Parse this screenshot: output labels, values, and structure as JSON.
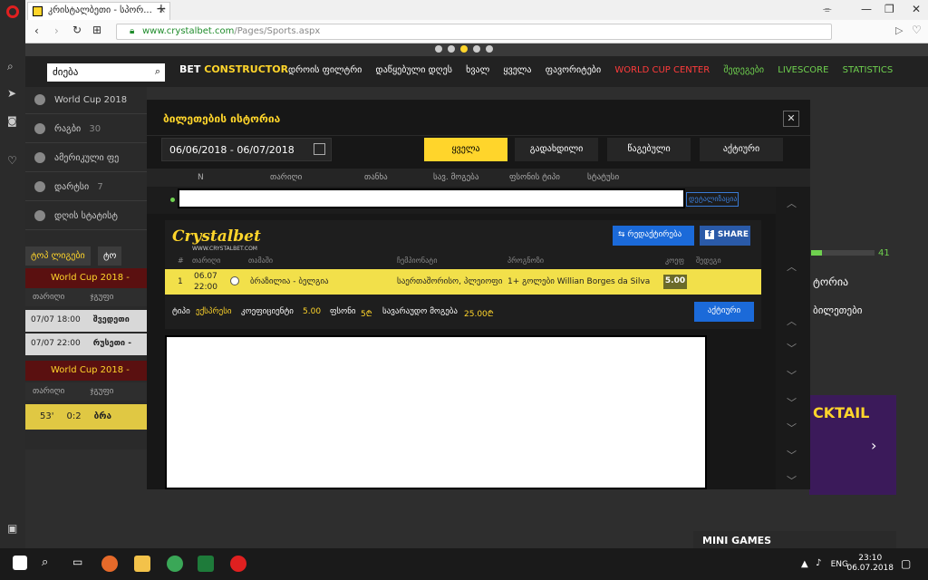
{
  "browser": {
    "tab_title": "კრისტალბეთი - სპორ...",
    "url_host": "www.crystalbet.com",
    "url_path": "/Pages/Sports.aspx"
  },
  "site": {
    "search_value": "ძიება",
    "bet_constructor_1": "BET",
    "bet_constructor_2": "CONSTRUCTOR",
    "nav": [
      "დროის ფილტრი",
      "დაწყებული დღეს",
      "ხვალ",
      "ყველა",
      "ფავორიტები",
      "WORLD CUP CENTER",
      "შედეგები",
      "LIVESCORE",
      "STATISTICS"
    ],
    "left_sports": [
      {
        "label": "World Cup 2018",
        "count": ""
      },
      {
        "label": "რაგბი",
        "count": "30"
      },
      {
        "label": "ამერიკული ფე",
        "count": ""
      },
      {
        "label": "დარტსი",
        "count": "7"
      },
      {
        "label": "დღის სტატისტ",
        "count": ""
      }
    ],
    "left_tabs": [
      "ტოპ ლიგები",
      "ტო"
    ],
    "group1": "World Cup 2018 -",
    "sub_date": "თარიღი",
    "sub_group": "ჯგუფი",
    "matches": [
      {
        "time": "07/07 18:00",
        "teams": "შვედეთი"
      },
      {
        "time": "07/07 22:00",
        "teams": "რუსეთი -"
      }
    ],
    "group2": "World Cup 2018 -",
    "live_minute": "53'",
    "live_score": "0:2",
    "live_team": "ბრა",
    "right_count": "41",
    "right_label": "ტორია",
    "right_label2": "ბილეთები",
    "cocktail": "CKTAIL",
    "mini_games": "MINI GAMES"
  },
  "modal": {
    "title": "ბილეთების ისტორია",
    "date_range": "06/06/2018 - 06/07/2018",
    "filters": [
      "ყველა",
      "გადახდილი",
      "წაგებული",
      "აქტიური"
    ],
    "columns": [
      "N",
      "თარიღი",
      "თანხა",
      "სავ. მოგება",
      "ფსონის ტიპი",
      "სტატუსი"
    ],
    "row1_button": "დეტალიზაცია"
  },
  "ticket": {
    "brand": "Crystalbet",
    "brand_sub": "WWW.CRYSTALBET.COM",
    "redact_btn": "რედაქტირება",
    "share_btn": "SHARE",
    "headers": [
      "#",
      "თარიღი",
      "თამაში",
      "ჩემპიონატი",
      "პროგნოზი",
      "კოეფ",
      "შედეგი"
    ],
    "row": {
      "num": "1",
      "date": "06.07",
      "time": "22:00",
      "match": "ბრაზილია - ბელგია",
      "champ": "საერთაშორისო, პლეიოფი",
      "pick": "1+ გოლები Willian Borges da Silva",
      "odds": "5.00"
    },
    "footer": {
      "type_label": "ტიპი",
      "type_value": "ექსპრესი",
      "coef_label": "კოეფიციენტი",
      "coef_value": "5.00",
      "stake_label": "ფსონი",
      "stake_value": "5₾",
      "win_label": "სავარაუდო მოგება",
      "win_value": "25.00₾",
      "status_btn": "აქტიური"
    }
  },
  "taskbar": {
    "lang": "ENG",
    "time": "23:10",
    "date": "06.07.2018"
  }
}
